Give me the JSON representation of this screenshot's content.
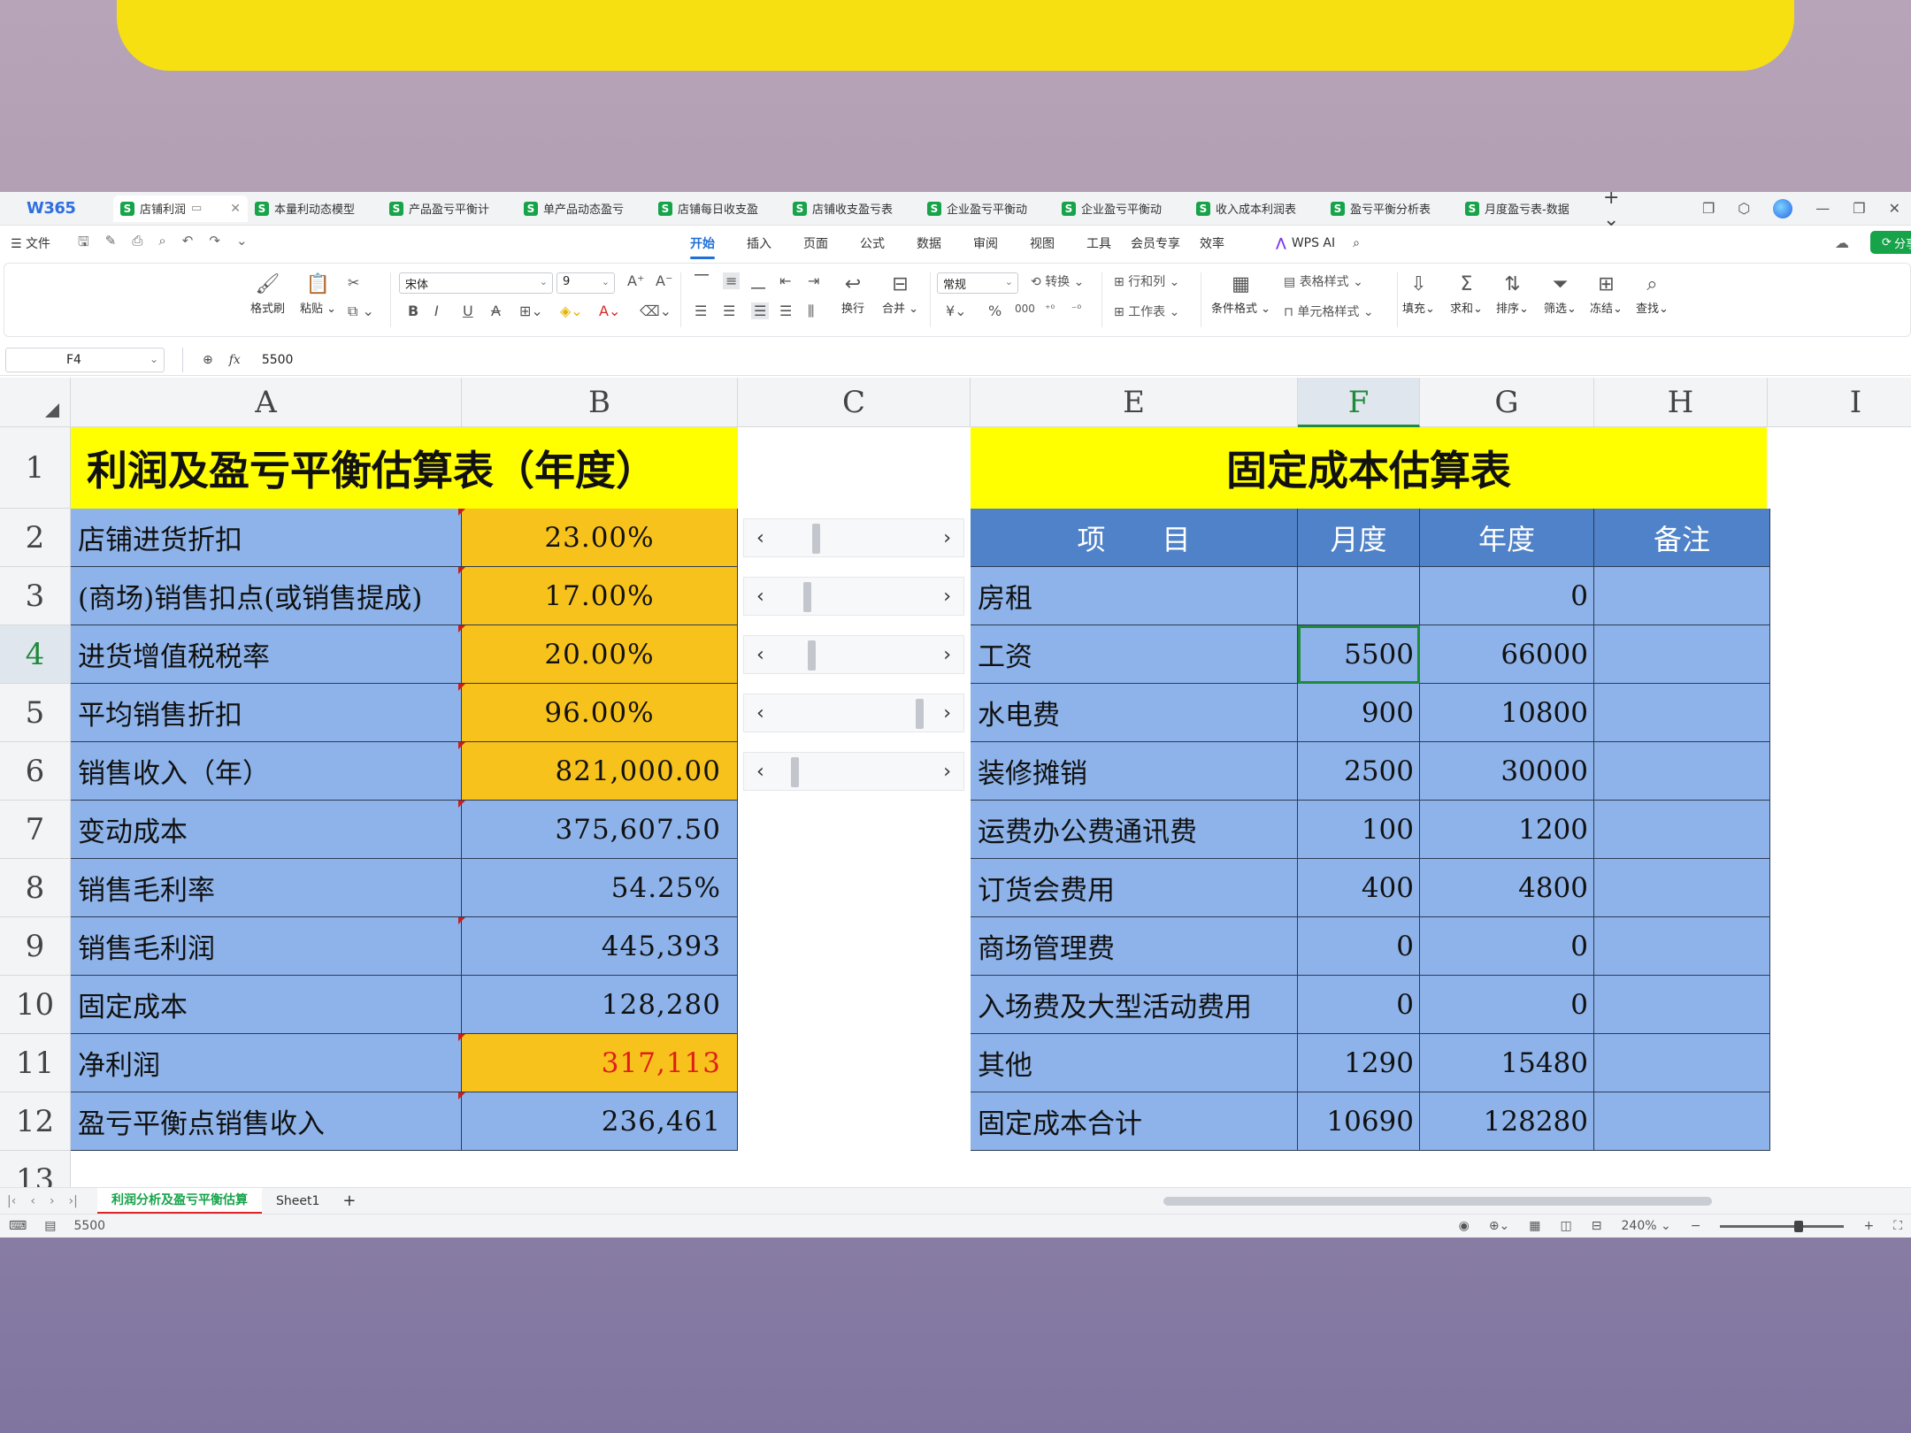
{
  "app": {
    "logo": "W365"
  },
  "doc_tabs": [
    {
      "label": "店铺利润"
    },
    {
      "label": "本量利动态模型"
    },
    {
      "label": "产品盈亏平衡计"
    },
    {
      "label": "单产品动态盈亏"
    },
    {
      "label": "店铺每日收支盈"
    },
    {
      "label": "店铺收支盈亏表"
    },
    {
      "label": "企业盈亏平衡动"
    },
    {
      "label": "企业盈亏平衡动"
    },
    {
      "label": "收入成本利润表"
    },
    {
      "label": "盈亏平衡分析表"
    },
    {
      "label": "月度盈亏表-数据"
    }
  ],
  "menu": {
    "file": "☰ 文件",
    "items": [
      "开始",
      "插入",
      "页面",
      "公式",
      "数据",
      "审阅",
      "视图",
      "工具",
      "会员专享",
      "效率"
    ],
    "active": "开始",
    "wps_ai": "WPS AI",
    "share": "分享"
  },
  "ribbon": {
    "format_painter": "格式刷",
    "paste": "粘贴",
    "font_name": "宋体",
    "font_size": "9",
    "wrap": "换行",
    "merge": "合并",
    "number_format": "常规",
    "convert": "转换",
    "row_col": "行和列",
    "worksheet": "工作表",
    "cond_format": "条件格式",
    "table_style": "表格样式",
    "cell_style": "单元格样式",
    "fill": "填充",
    "sum": "求和",
    "sort": "排序",
    "filter": "筛选",
    "freeze": "冻结",
    "find": "查找"
  },
  "formula_bar": {
    "name_box": "F4",
    "fx": "fx",
    "value": "5500"
  },
  "columns": [
    "A",
    "B",
    "C",
    "E",
    "F",
    "G",
    "H",
    "I"
  ],
  "rows": [
    "1",
    "2",
    "3",
    "4",
    "5",
    "6",
    "7",
    "8",
    "9",
    "10",
    "11",
    "12",
    "13"
  ],
  "left_table": {
    "title": "利润及盈亏平衡估算表（年度）",
    "rows": [
      {
        "label": "店铺进货折扣",
        "value": "23.00%"
      },
      {
        "label": "(商场)销售扣点(或销售提成)",
        "value": "17.00%"
      },
      {
        "label": "进货增值税税率",
        "value": "20.00%"
      },
      {
        "label": "平均销售折扣",
        "value": "96.00%"
      },
      {
        "label": "销售收入（年）",
        "value": "821,000.00"
      },
      {
        "label": "变动成本",
        "value": "375,607.50"
      },
      {
        "label": "销售毛利率",
        "value": "54.25%"
      },
      {
        "label": "销售毛利润",
        "value": "445,393"
      },
      {
        "label": "固定成本",
        "value": "128,280"
      },
      {
        "label": "净利润",
        "value": "317,113"
      },
      {
        "label": "盈亏平衡点销售收入",
        "value": "236,461"
      }
    ]
  },
  "scrollbars": [
    {
      "position": 0.23
    },
    {
      "position": 0.17
    },
    {
      "position": 0.2
    },
    {
      "position": 0.96
    },
    {
      "position": 0.08
    }
  ],
  "right_table": {
    "title": "固定成本估算表",
    "headers": [
      "项　　目",
      "月度",
      "年度",
      "备注"
    ],
    "rows": [
      {
        "item": "房租",
        "monthly": "",
        "annual": "0",
        "note": ""
      },
      {
        "item": "工资",
        "monthly": "5500",
        "annual": "66000",
        "note": ""
      },
      {
        "item": "水电费",
        "monthly": "900",
        "annual": "10800",
        "note": ""
      },
      {
        "item": "装修摊销",
        "monthly": "2500",
        "annual": "30000",
        "note": ""
      },
      {
        "item": "运费办公费通讯费",
        "monthly": "100",
        "annual": "1200",
        "note": ""
      },
      {
        "item": "订货会费用",
        "monthly": "400",
        "annual": "4800",
        "note": ""
      },
      {
        "item": "商场管理费",
        "monthly": "0",
        "annual": "0",
        "note": ""
      },
      {
        "item": "入场费及大型活动费用",
        "monthly": "0",
        "annual": "0",
        "note": ""
      },
      {
        "item": "其他",
        "monthly": "1290",
        "annual": "15480",
        "note": ""
      },
      {
        "item": "固定成本合计",
        "monthly": "10690",
        "annual": "128280",
        "note": ""
      }
    ]
  },
  "sheets": [
    "利润分析及盈亏平衡估算",
    "Sheet1"
  ],
  "status": {
    "value": "5500",
    "zoom": "240%"
  }
}
